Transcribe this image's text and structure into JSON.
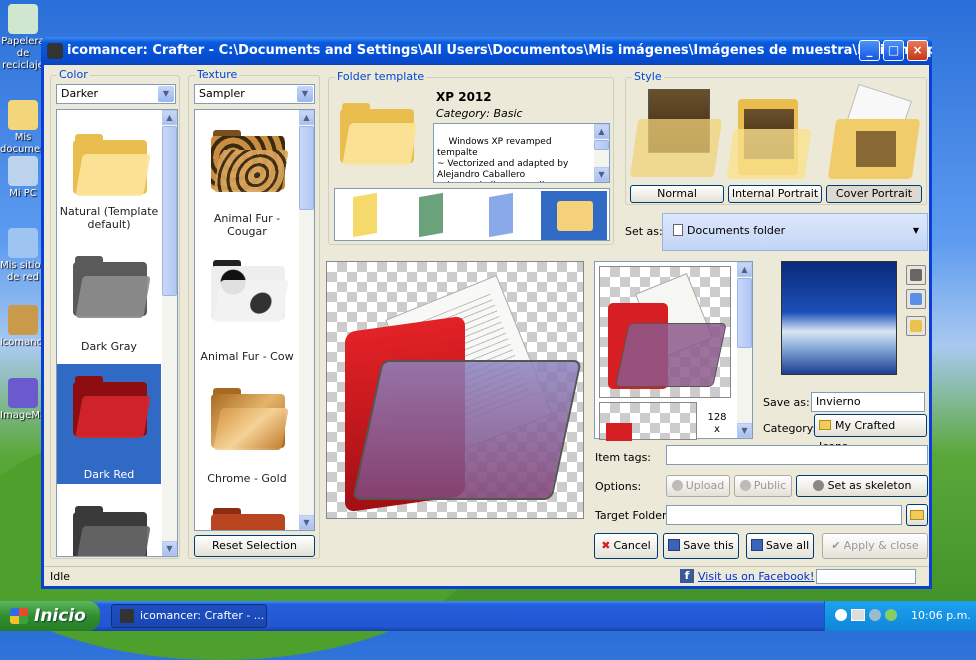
{
  "desktop": {
    "icons": [
      {
        "label": "Papelera de reciclaje"
      },
      {
        "label": "Mis documentos"
      },
      {
        "label": "Mi PC"
      },
      {
        "label": "Mis sitios de red"
      },
      {
        "label": "icomancer"
      },
      {
        "label": "ImageMagick"
      }
    ]
  },
  "window": {
    "title": "icomancer: Crafter - C:\\Documents and Settings\\All Users\\Documentos\\Mis imágenes\\Imágenes de muestra\\Invierno.jpg",
    "buttons": {
      "minimize": "_",
      "maximize": "□",
      "close": "×"
    }
  },
  "color": {
    "label": "Color",
    "selected": "Darker",
    "items": [
      {
        "label": "Natural (Template default)",
        "fill": "#f7d67a"
      },
      {
        "label": "Dark Gray",
        "fill": "#7a7a7a"
      },
      {
        "label": "Dark Red",
        "fill": "#c8161b"
      },
      {
        "label": "",
        "fill": "#555555"
      }
    ],
    "selected_index": 2
  },
  "texture": {
    "label": "Texture",
    "selected": "Sampler",
    "items": [
      {
        "label": "Animal Fur - Cougar",
        "fill": "#b87a35"
      },
      {
        "label": "Animal Fur - Cow",
        "fill": "#e8e8e8"
      },
      {
        "label": "Chrome - Gold",
        "fill": "#c78a35"
      },
      {
        "label": "",
        "fill": "#b8451f"
      }
    ],
    "reset_label": "Reset Selection"
  },
  "folder_template": {
    "label": "Folder template",
    "name": "XP 2012",
    "category": "Category: Basic",
    "description": "Windows XP revamped tempalte\n~ Vectorized and adapted by Alejandro Caballero\n~ lava.caballero@gmail.com",
    "variants": [
      "#f5d96a",
      "#6aa37b",
      "#8aa9e8",
      "#f5d27a"
    ]
  },
  "style": {
    "label": "Style",
    "options": [
      "Normal",
      "Internal Portrait",
      "Cover Portrait"
    ],
    "selected": "Cover Portrait"
  },
  "set_as": {
    "label": "Set as:",
    "value": "Documents folder"
  },
  "preview": {
    "size_label": "128\nx"
  },
  "source": {
    "save_as_label": "Save as:",
    "save_as_value": "Invierno",
    "category_label": "Category:",
    "category_value": "My Crafted Icons"
  },
  "form": {
    "tags_label": "Item tags:",
    "tags_value": "",
    "options_label": "Options:",
    "upload": "Upload",
    "public": "Public",
    "skeleton": "Set as skeleton",
    "target_label": "Target Folder:",
    "target_value": ""
  },
  "actions": {
    "cancel": "Cancel",
    "save_this": "Save this",
    "save_all": "Save all",
    "apply_close": "Apply & close"
  },
  "status": {
    "text": "Idle",
    "facebook": "Visit us on Facebook!"
  },
  "taskbar": {
    "start": "Inicio",
    "task": "icomancer: Crafter - ...",
    "clock": "10:06 p.m."
  }
}
